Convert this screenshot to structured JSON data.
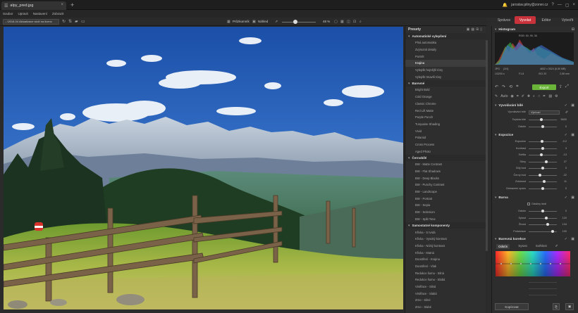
{
  "titlebar": {
    "tab_title": "alpy_pred.jpg",
    "user": "jaroslav.pilny@zoner.cz"
  },
  "menu": [
    "Soubor",
    "Upravit",
    "Nastavení",
    "Zobrazit"
  ],
  "modes": [
    {
      "label": "Správce",
      "active": false
    },
    {
      "label": "Vyvolat",
      "active": true
    },
    {
      "label": "Editor",
      "active": false
    },
    {
      "label": "Vytvořit",
      "active": false
    }
  ],
  "toolbar": {
    "path": "...\\2018-04 Aktualizace složí na licenc",
    "compare_label": "Průzkumník",
    "before_label": "Náhled",
    "zoom": "48 %"
  },
  "presets": {
    "title": "Presety",
    "groups": [
      {
        "name": "Automatické vylepšení",
        "items": [
          "Plná automatika",
          "Zvýraznit detaily",
          "Portrét",
          "Krajina",
          "Vylepšit hojnější tóny",
          "Vylepšit tmavší tóny"
        ],
        "selected": "Krajina"
      },
      {
        "name": "Barevné",
        "items": [
          "Bright Bold",
          "Cold Orange",
          "Classic Chrome",
          "Red Lift Matte",
          "Purple Punch",
          "Turquoise Shading",
          "Vivid",
          "Polaroid",
          "Cross Process",
          "Aged Photo"
        ]
      },
      {
        "name": "Černobílé",
        "items": [
          "BW - Matte Contrast",
          "BW - Flat Shadows",
          "BW - Deep Blacks",
          "BW - Punchy Contrast",
          "BW - Landscape",
          "BW - Portrait",
          "BW - Sepia",
          "BW - Selenium",
          "BW - Split Tone"
        ]
      },
      {
        "name": "Samostatné komponenty",
        "items": [
          "Křivka - S tvrdá",
          "Křivka - Vysoký kontrast",
          "Křivka - Nízký kontrast",
          "Křivka - Matná",
          "Doostření - Krajina",
          "Doostření - Vlak",
          "Redukce šumu - Silná",
          "Redukce šumu - Slabá",
          "Viněface - Silná",
          "Viněface - Slabá",
          "Zrno - Silné",
          "Zrno - Slabé"
        ]
      }
    ]
  },
  "histogram": {
    "title": "Histogram",
    "rgb": "RGB: 50, 95, 36",
    "format": "JPG",
    "ratio": "(2/4)",
    "dimensions": "4832 x 3024 (6,50 MB)",
    "shutter": "1/3200 s",
    "aperture": "F1.8",
    "iso": "ISO 20",
    "focal": "2,58 mm"
  },
  "quicktools": {
    "auto_label": "Auto",
    "export_label": "Export"
  },
  "white_balance": {
    "title": "Vyvolávání bílé",
    "preset_label": "Vyvolávání bílé",
    "preset_value": "Výchozí",
    "rows": [
      {
        "label": "Teplota bílé",
        "value": "5600",
        "pos": 0.45
      },
      {
        "label": "Odstín",
        "value": "0",
        "pos": 0.5
      }
    ]
  },
  "exposure": {
    "title": "Expozice",
    "rows": [
      {
        "label": "Expozice",
        "value": "-0.2",
        "pos": 0.48
      },
      {
        "label": "Kontrast",
        "value": "3",
        "pos": 0.51
      },
      {
        "label": "Světla",
        "value": "-13",
        "pos": 0.44
      },
      {
        "label": "Stíny",
        "value": "27",
        "pos": 0.62
      },
      {
        "label": "Bílý bod",
        "value": "0",
        "pos": 0.5
      },
      {
        "label": "Černý bod",
        "value": "-22",
        "pos": 0.39
      },
      {
        "label": "Zvlsinost",
        "value": "11",
        "pos": 0.55
      },
      {
        "label": "Odmavení oparu",
        "value": "0",
        "pos": 0.5
      }
    ]
  },
  "color": {
    "title": "Barva",
    "checkbox": "Odstíny šedi",
    "rows": [
      {
        "label": "Odstín",
        "value": "0",
        "pos": 0.5
      },
      {
        "label": "Sytost",
        "value": "120",
        "pos": 0.62
      },
      {
        "label": "Živost",
        "value": "134",
        "pos": 0.68
      },
      {
        "label": "Polarizace",
        "value": "100",
        "pos": 0.86
      }
    ]
  },
  "hsl": {
    "title": "Barevná korekce",
    "tabs": [
      "Odstín",
      "Sytost",
      "Světlost"
    ],
    "active": "Odstín"
  },
  "bottom": {
    "copy_label": "Kopírovat"
  }
}
